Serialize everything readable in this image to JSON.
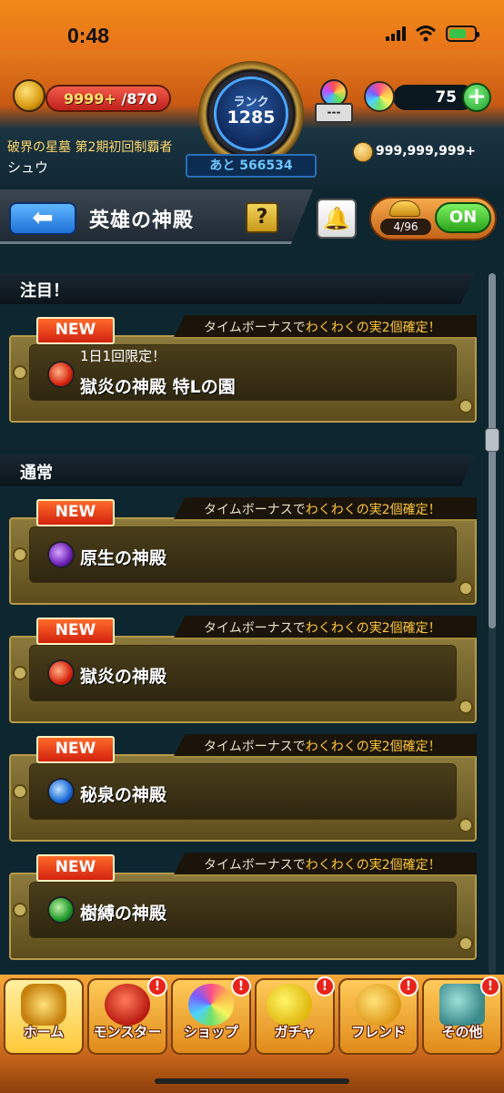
{
  "status_bar": {
    "time": "0:48"
  },
  "header": {
    "stamina": "9999+",
    "stamina_max": "/870",
    "rank_label": "ランク",
    "rank_value": "1285",
    "next_exp": "あと 566534",
    "orb_slot": "---",
    "orb_count": "75",
    "plus": "+",
    "title": "破界の星墓 第2期初回制覇者",
    "player_name": "シュウ",
    "coins": "999,999,999+"
  },
  "titlebar": {
    "back": "⬅",
    "title": "英雄の神殿",
    "help": "?",
    "bell": "🔔",
    "fruit_count": "4/96",
    "toggle": "ON"
  },
  "sections": [
    {
      "label": "注目！"
    },
    {
      "label": "通常"
    }
  ],
  "cards": [
    {
      "new": "NEW",
      "banner_prefix": "タイムボーナスで",
      "banner_highlight": "わくわくの実2個確定！",
      "sub": "1日1回限定！",
      "name": "獄炎の神殿 特Lの園",
      "element": "fire"
    },
    {
      "new": "NEW",
      "banner_prefix": "タイムボーナスで",
      "banner_highlight": "わくわくの実2個確定！",
      "sub": "",
      "name": "原生の神殿",
      "element": "dark"
    },
    {
      "new": "NEW",
      "banner_prefix": "タイムボーナスで",
      "banner_highlight": "わくわくの実2個確定！",
      "sub": "",
      "name": "獄炎の神殿",
      "element": "fire"
    },
    {
      "new": "NEW",
      "banner_prefix": "タイムボーナスで",
      "banner_highlight": "わくわくの実2個確定！",
      "sub": "",
      "name": "秘泉の神殿",
      "element": "water"
    },
    {
      "new": "NEW",
      "banner_prefix": "タイムボーナスで",
      "banner_highlight": "わくわくの実2個確定！",
      "sub": "",
      "name": "樹縛の神殿",
      "element": "wood"
    }
  ],
  "tabs": [
    {
      "label": "ホーム",
      "badge": ""
    },
    {
      "label": "モンスター",
      "badge": "!"
    },
    {
      "label": "ショップ",
      "badge": "!"
    },
    {
      "label": "ガチャ",
      "badge": "!"
    },
    {
      "label": "フレンド",
      "badge": "!"
    },
    {
      "label": "その他",
      "badge": "!"
    }
  ],
  "colors": {
    "accent_orange": "#e8741a",
    "highlight_gold": "#ffc83a",
    "new_red": "#d2220f",
    "on_green": "#2aa41a"
  }
}
